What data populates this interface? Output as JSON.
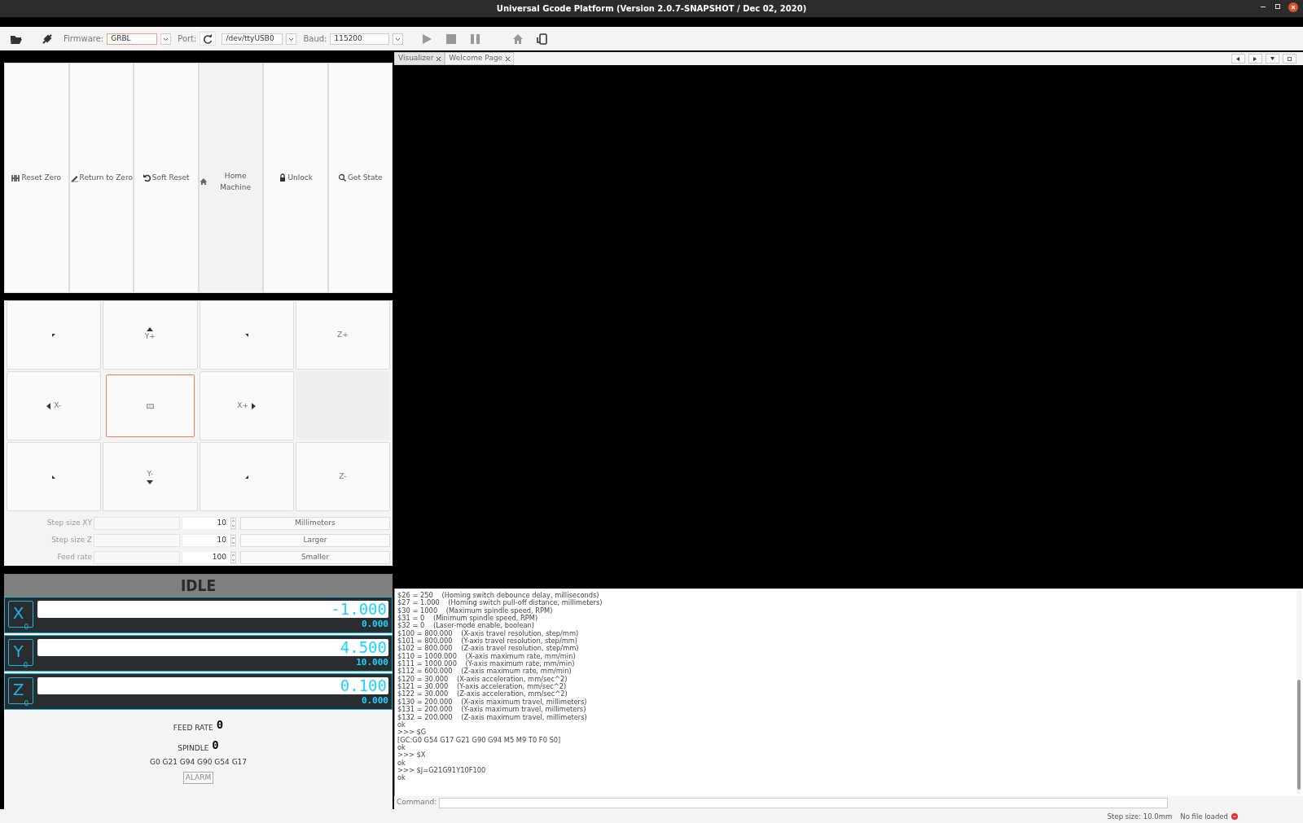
{
  "window": {
    "title": "Universal Gcode Platform (Version 2.0.7-SNAPSHOT / Dec 02, 2020)"
  },
  "toolbar": {
    "firmware_label": "Firmware:",
    "firmware": "GRBL",
    "port_label": "Port:",
    "port": "/dev/ttyUSB0",
    "baud_label": "Baud:",
    "baud": "115200"
  },
  "actions": [
    {
      "label": "Reset Zero",
      "kind": "reset"
    },
    {
      "label": "Return to Zero",
      "kind": "return"
    },
    {
      "label": "Soft Reset",
      "kind": "soft"
    },
    {
      "label": "Home Machine",
      "kind": "home"
    },
    {
      "label": "Unlock",
      "kind": "unlock"
    },
    {
      "label": "Get State",
      "kind": "state"
    }
  ],
  "jog": [
    {
      "kind": "nw",
      "focused": false
    },
    {
      "kind": "n",
      "label": "Y+",
      "focused": false
    },
    {
      "kind": "ne",
      "focused": false
    },
    {
      "kind": "zplus",
      "label": "Z+",
      "focused": false
    },
    {
      "kind": "w",
      "label": "X-",
      "focused": false
    },
    {
      "kind": "center",
      "focused": true
    },
    {
      "kind": "e",
      "label": "X+",
      "focused": false
    },
    {
      "kind": "blank"
    },
    {
      "kind": "sw",
      "focused": false
    },
    {
      "kind": "s",
      "label": "Y-",
      "focused": false
    },
    {
      "kind": "se",
      "focused": false
    },
    {
      "kind": "zminus",
      "label": "Z-",
      "focused": false
    }
  ],
  "step_rows": [
    {
      "label": "Step size XY",
      "value": "10",
      "button": "Millimeters"
    },
    {
      "label": "Step size Z",
      "value": "10",
      "button": "Larger"
    },
    {
      "label": "Feed rate",
      "value": "100",
      "button": "Smaller"
    }
  ],
  "state": "IDLE",
  "dro": [
    {
      "axis": "X",
      "sub": "0",
      "work": "-1.000",
      "machine": "0.000"
    },
    {
      "axis": "Y",
      "sub": "0",
      "work": "4.500",
      "machine": "10.000"
    },
    {
      "axis": "Z",
      "sub": "0",
      "work": "0.100",
      "machine": "0.000"
    }
  ],
  "feed_rate": {
    "label": "FEED RATE",
    "value": "0"
  },
  "spindle": {
    "label": "SPINDLE",
    "value": "0"
  },
  "gcode_state": "G0 G21 G94 G90 G54 G17",
  "alarm": "ALARM",
  "tabs": [
    {
      "label": "Visualizer",
      "selected": true
    },
    {
      "label": "Welcome Page",
      "selected": false
    }
  ],
  "console": {
    "lines": [
      "$26 = 250    (Homing switch debounce delay, milliseconds)",
      "$27 = 1.000    (Homing switch pull-off distance, millimeters)",
      "$30 = 1000    (Maximum spindle speed, RPM)",
      "$31 = 0    (Minimum spindle speed, RPM)",
      "$32 = 0    (Laser-mode enable, boolean)",
      "$100 = 800.000    (X-axis travel resolution, step/mm)",
      "$101 = 800.000    (Y-axis travel resolution, step/mm)",
      "$102 = 800.000    (Z-axis travel resolution, step/mm)",
      "$110 = 1000.000    (X-axis maximum rate, mm/min)",
      "$111 = 1000.000    (Y-axis maximum rate, mm/min)",
      "$112 = 600.000    (Z-axis maximum rate, mm/min)",
      "$120 = 30.000    (X-axis acceleration, mm/sec^2)",
      "$121 = 30.000    (Y-axis acceleration, mm/sec^2)",
      "$122 = 30.000    (Z-axis acceleration, mm/sec^2)",
      "$130 = 200.000    (X-axis maximum travel, millimeters)",
      "$131 = 200.000    (Y-axis maximum travel, millimeters)",
      "$132 = 200.000    (Z-axis maximum travel, millimeters)",
      "ok",
      ">>> $G",
      "[GC:G0 G54 G17 G21 G90 G94 M5 M9 T0 F0 S0]",
      "ok",
      ">>> $X",
      "ok",
      ">>> $J=G21G91Y10F100",
      "ok"
    ],
    "command_label": "Command:"
  },
  "status_bar": {
    "step_size": "Step size: 10.0mm",
    "file": "No file loaded"
  }
}
